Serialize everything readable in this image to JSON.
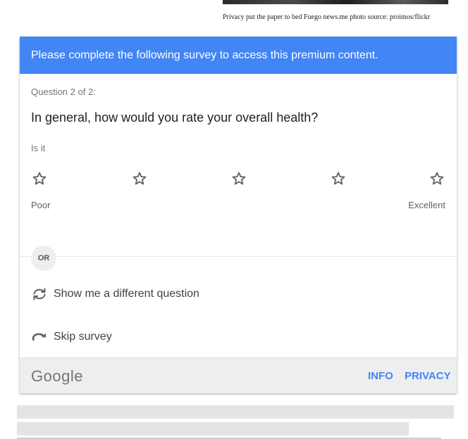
{
  "caption": "Privacy put the paper to bed Fuego news.me photo source: proimos/flickr",
  "survey": {
    "banner": "Please complete the following survey to access this premium content.",
    "question_number": "Question 2 of 2:",
    "question": "In general, how would you rate your overall health?",
    "prompt": "Is it",
    "rating": {
      "stars": 5,
      "selected": 0
    },
    "low_label": "Poor",
    "high_label": "Excellent",
    "or_label": "OR",
    "different_question": "Show me a different question",
    "skip": "Skip survey"
  },
  "footer": {
    "logo": "Google",
    "info": "INFO",
    "privacy": "PRIVACY"
  },
  "colors": {
    "accent": "#4285f4",
    "footer_bg": "#eeeeee"
  }
}
